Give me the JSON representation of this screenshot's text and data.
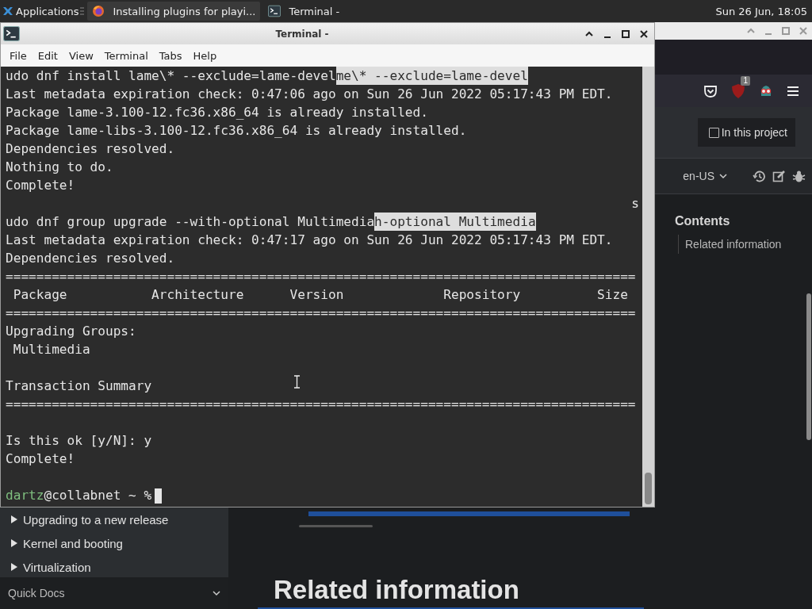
{
  "taskbar": {
    "menu_label": "Applications",
    "tasks": [
      {
        "label": "Installing plugins for playi...",
        "kind": "browser",
        "selected": true
      },
      {
        "label": "Terminal -",
        "kind": "terminal",
        "selected": false
      }
    ],
    "clock": "Sun 26 Jun, 18:05"
  },
  "browser": {
    "addon_badge": "1",
    "search_option": {
      "label": "In this project",
      "checked": false
    },
    "language": "en-US",
    "toc": {
      "title": "Contents",
      "items": [
        "Related information"
      ]
    },
    "sidebar_items": [
      {
        "label": "Upgrading to a new release",
        "expanded": false
      },
      {
        "label": "Kernel and booting",
        "expanded": false
      },
      {
        "label": "Virtualization",
        "expanded": false
      }
    ],
    "sidebar_footer": "Quick Docs",
    "heading": "Related information"
  },
  "terminal": {
    "title": "Terminal -",
    "menu": [
      "File",
      "Edit",
      "View",
      "Terminal",
      "Tabs",
      "Help"
    ],
    "lines": [
      {
        "kind": "text",
        "segments": [
          {
            "text": "udo dnf install lame\\* --exclude=lame-devel",
            "selected": false
          },
          {
            "text": "me\\* --exclude=lame-devel",
            "selected": true
          }
        ]
      },
      {
        "kind": "text",
        "segments": [
          {
            "text": "Last metadata expiration check: 0:47:06 ago on Sun 26 Jun 2022 05:17:43 PM EDT.",
            "selected": false
          }
        ]
      },
      {
        "kind": "text",
        "segments": [
          {
            "text": "Package lame-3.100-12.fc36.x86_64 is already installed.",
            "selected": false
          }
        ]
      },
      {
        "kind": "text",
        "segments": [
          {
            "text": "Package lame-libs-3.100-12.fc36.x86_64 is already installed.",
            "selected": false
          }
        ]
      },
      {
        "kind": "text",
        "segments": [
          {
            "text": "Dependencies resolved.",
            "selected": false
          }
        ]
      },
      {
        "kind": "text",
        "segments": [
          {
            "text": "Nothing to do.",
            "selected": false
          }
        ]
      },
      {
        "kind": "text",
        "segments": [
          {
            "text": "Complete!",
            "selected": false
          }
        ]
      },
      {
        "kind": "right",
        "text": "s"
      },
      {
        "kind": "text",
        "segments": [
          {
            "text": "udo dnf group upgrade --with-optional Multimedia",
            "selected": false
          },
          {
            "text": "h-optional Multimedia",
            "selected": true
          }
        ]
      },
      {
        "kind": "text",
        "segments": [
          {
            "text": "Last metadata expiration check: 0:47:17 ago on Sun 26 Jun 2022 05:17:43 PM EDT.",
            "selected": false
          }
        ]
      },
      {
        "kind": "text",
        "segments": [
          {
            "text": "Dependencies resolved.",
            "selected": false
          }
        ]
      },
      {
        "kind": "text",
        "segments": [
          {
            "text": "==================================================================================",
            "selected": false
          }
        ]
      },
      {
        "kind": "text",
        "segments": [
          {
            "text": " Package           Architecture      Version             Repository          Size",
            "selected": false
          }
        ]
      },
      {
        "kind": "text",
        "segments": [
          {
            "text": "==================================================================================",
            "selected": false
          }
        ]
      },
      {
        "kind": "text",
        "segments": [
          {
            "text": "Upgrading Groups:",
            "selected": false
          }
        ]
      },
      {
        "kind": "text",
        "segments": [
          {
            "text": " Multimedia",
            "selected": false
          }
        ]
      },
      {
        "kind": "blank"
      },
      {
        "kind": "text",
        "segments": [
          {
            "text": "Transaction Summary",
            "selected": false
          }
        ]
      },
      {
        "kind": "text",
        "segments": [
          {
            "text": "==================================================================================",
            "selected": false
          }
        ]
      },
      {
        "kind": "blank"
      },
      {
        "kind": "text",
        "segments": [
          {
            "text": "Is this ok [y/N]: y",
            "selected": false
          }
        ]
      },
      {
        "kind": "text",
        "segments": [
          {
            "text": "Complete!",
            "selected": false
          }
        ]
      },
      {
        "kind": "blank"
      },
      {
        "kind": "prompt",
        "user": "dartz",
        "rest": "@collabnet ~ %"
      }
    ]
  }
}
